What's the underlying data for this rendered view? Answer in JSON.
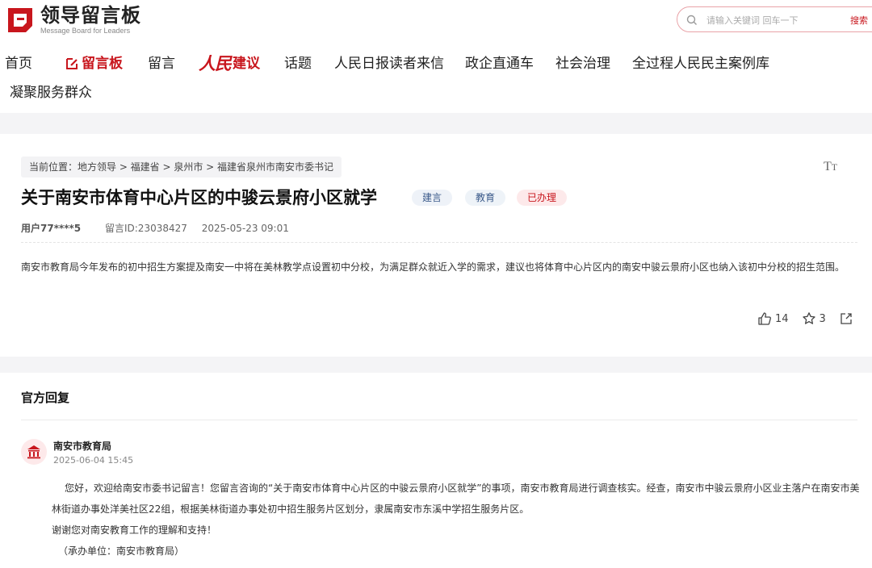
{
  "site": {
    "logo_title": "领导留言板",
    "logo_subtitle": "Message Board for Leaders",
    "brand_color": "#c8161d"
  },
  "search": {
    "placeholder": "请输入关键词 回车一下",
    "button_label": "搜索",
    "icon": "search-icon"
  },
  "nav": {
    "items": [
      "首页",
      "留言板",
      "留言",
      "建议",
      "话题",
      "人民日报读者来信",
      "政企直通车",
      "社会治理",
      "全过程人民民主案例库",
      "凝聚服务群众"
    ],
    "rm_script": "人民",
    "active_index": 1
  },
  "breadcrumb": "当前位置：地方领导 > 福建省 > 泉州市 > 福建省泉州市南安市委书记",
  "post": {
    "title": "关于南安市体育中心片区的中骏云景府小区就学",
    "tags": [
      "建言",
      "教育",
      "已办理"
    ],
    "user": "用户77****5",
    "message_id": "留言ID:23038427",
    "datetime": "2025-05-23 09:01",
    "body": "南安市教育局今年发布的初中招生方案提及南安一中将在美林教学点设置初中分校，为满足群众就近入学的需求，建议也将体育中心片区内的南安中骏云景府小区也纳入该初中分校的招生范围。",
    "likes": "14",
    "favorites": "3"
  },
  "reply": {
    "heading": "官方回复",
    "org": "南安市教育局",
    "datetime": "2025-06-04 15:45",
    "paragraph1": "您好，欢迎给南安市委书记留言！您留言咨询的“关于南安市体育中心片区的中骏云景府小区就学”的事项，南安市教育局进行调查核实。经查，南安市中骏云景府小区业主落户在南安市美林街道办事处洋美社区22组，根据美林街道办事处初中招生服务片区划分，隶属南安市东溪中学招生服务片区。",
    "paragraph2": "谢谢您对南安教育工作的理解和支持！",
    "signature": "（承办单位：南安市教育局）"
  }
}
